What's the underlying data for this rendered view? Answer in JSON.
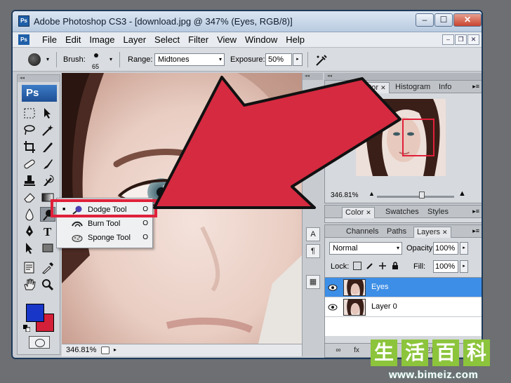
{
  "window": {
    "title": "Adobe Photoshop CS3 - [download.jpg @ 347% (Eyes, RGB/8)]",
    "app_icon": "Ps",
    "controls": {
      "minimize": "–",
      "maximize": "☐",
      "close": "✕"
    }
  },
  "menubar": {
    "doc_icon": "Ps",
    "items": [
      "File",
      "Edit",
      "Image",
      "Layer",
      "Select",
      "Filter",
      "View",
      "Window",
      "Help"
    ],
    "mdi": {
      "minimize": "–",
      "restore": "❐",
      "close": "✕"
    }
  },
  "options": {
    "brush_label": "Brush:",
    "brush_size": "65",
    "range_label": "Range:",
    "range_value": "Midtones",
    "exposure_label": "Exposure:",
    "exposure_value": "50%",
    "arrow": "▸",
    "dropdown_arrow": "▾"
  },
  "toolbox": {
    "grip": "◂◂",
    "logo": "Ps"
  },
  "flyout": {
    "items": [
      {
        "label": "Dodge Tool",
        "key": "O",
        "active": true
      },
      {
        "label": "Burn Tool",
        "key": "O",
        "active": false
      },
      {
        "label": "Sponge Tool",
        "key": "O",
        "active": false
      }
    ],
    "bullet": "■"
  },
  "status": {
    "zoom": "346.81%",
    "arrow": "▸"
  },
  "dock": {
    "grip": "◂◂",
    "buttons": [
      "↺",
      "▤",
      "A",
      "¶",
      "▦"
    ]
  },
  "panels": {
    "grip": "◂◂",
    "navigator": {
      "tabs": [
        "Navigator",
        "Histogram",
        "Info"
      ],
      "zoom": "346.81%",
      "zoom_out": "▲",
      "zoom_in": "▲"
    },
    "color": {
      "tabs": [
        "Color",
        "Swatches",
        "Styles"
      ]
    },
    "layers": {
      "tabs": [
        "Channels",
        "Paths",
        "Layers"
      ],
      "blend_mode": "Normal",
      "opacity_label": "Opacity:",
      "opacity_value": "100%",
      "lock_label": "Lock:",
      "fill_label": "Fill:",
      "fill_value": "100%",
      "rows": [
        {
          "name": "Eyes",
          "selected": true
        },
        {
          "name": "Layer 0",
          "selected": false
        }
      ],
      "footer_icons": [
        "∞",
        "fx",
        "◘",
        "◐",
        "▭",
        "◰",
        "🗑"
      ]
    },
    "close_x": "✕",
    "menu": "▸≡"
  },
  "watermark": {
    "chars": [
      "生",
      "活",
      "百",
      "科"
    ],
    "url": "www.bimeiz.com"
  },
  "colors": {
    "foreground": "#1836c8",
    "background": "#d42039",
    "highlight": "#e0203a",
    "selection": "#3d8ee6",
    "watermark": "#8cc43c"
  }
}
